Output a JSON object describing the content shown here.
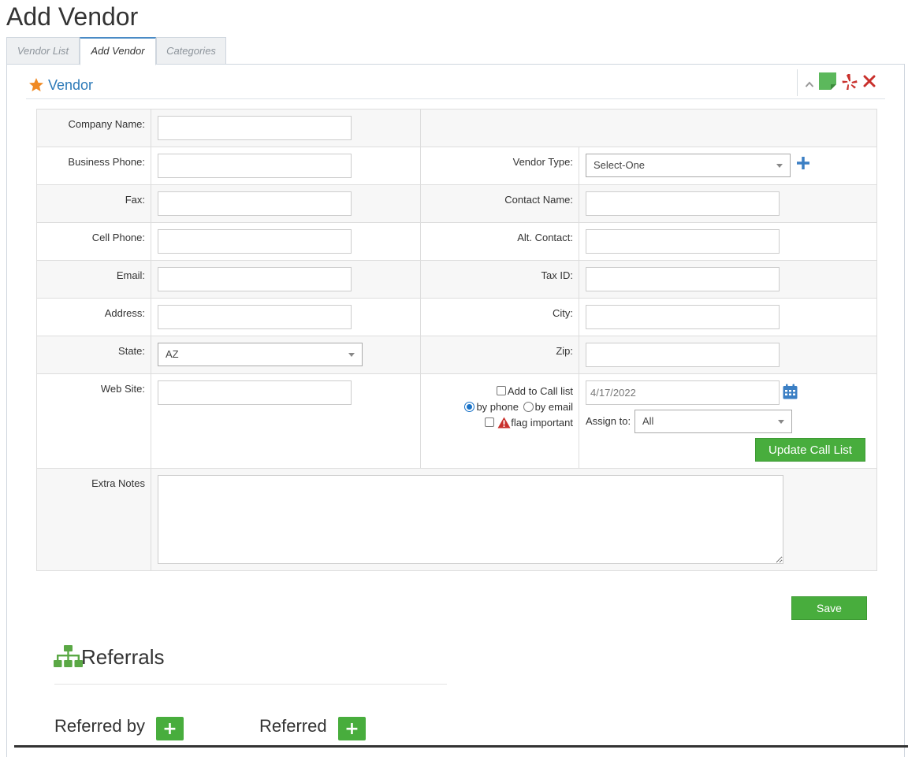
{
  "page": {
    "title": "Add Vendor"
  },
  "tabs": [
    {
      "label": "Vendor List",
      "active": false
    },
    {
      "label": "Add Vendor",
      "active": true
    },
    {
      "label": "Categories",
      "active": false
    }
  ],
  "panel": {
    "icon": "star-icon",
    "title": "Vendor",
    "header_icons": [
      "chevron-up-icon",
      "sticky-note-icon",
      "yelp-icon",
      "close-icon"
    ]
  },
  "form": {
    "company_name": {
      "label": "Company Name:",
      "value": ""
    },
    "business_phone": {
      "label": "Business Phone:",
      "value": ""
    },
    "vendor_type": {
      "label": "Vendor Type:",
      "selected": "Select-One"
    },
    "fax": {
      "label": "Fax:",
      "value": ""
    },
    "contact_name": {
      "label": "Contact Name:",
      "value": ""
    },
    "cell_phone": {
      "label": "Cell Phone:",
      "value": ""
    },
    "alt_contact": {
      "label": "Alt. Contact:",
      "value": ""
    },
    "email": {
      "label": "Email:",
      "value": ""
    },
    "tax_id": {
      "label": "Tax ID:",
      "value": ""
    },
    "address": {
      "label": "Address:",
      "value": ""
    },
    "city": {
      "label": "City:",
      "value": ""
    },
    "state": {
      "label": "State:",
      "selected": "AZ"
    },
    "zip": {
      "label": "Zip:",
      "value": ""
    },
    "web_site": {
      "label": "Web Site:",
      "value": ""
    },
    "extra_notes": {
      "label": "Extra Notes",
      "value": ""
    }
  },
  "call_list": {
    "add_label": "Add to Call list",
    "add_checked": false,
    "by_phone_label": "by phone",
    "by_phone_checked": true,
    "by_email_label": "by email",
    "by_email_checked": false,
    "flag_label": "flag important",
    "flag_checked": false,
    "date": "4/17/2022",
    "assign_label": "Assign to:",
    "assign_selected": "All",
    "update_label": "Update Call List"
  },
  "actions": {
    "save_label": "Save"
  },
  "referrals": {
    "icon": "sitemap-icon",
    "title": "Referrals",
    "referred_by_label": "Referred by",
    "referred_label": "Referred",
    "add_symbol": "+"
  },
  "colors": {
    "accent_blue": "#2d7ab8",
    "action_green": "#48ad3d",
    "star_orange": "#f08a24",
    "danger_red": "#c9302c"
  }
}
